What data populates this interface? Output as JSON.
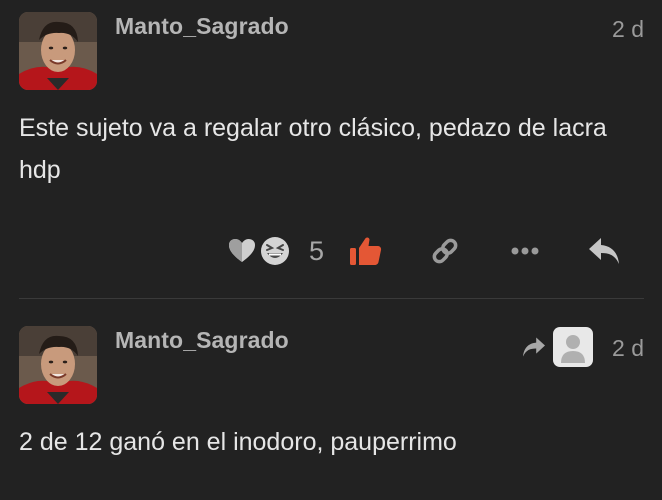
{
  "posts": [
    {
      "username": "Manto_Sagrado",
      "date": "2 d",
      "text": "Este sujeto va a regalar otro clásico, pedazo de lacra hdp",
      "reactions": {
        "icons": [
          "heart-icon",
          "grinning-squint-emoji"
        ],
        "count": "5"
      },
      "actions": [
        "thumbs-up-icon",
        "link-icon",
        "more-icon",
        "reply-icon"
      ]
    },
    {
      "username": "Manto_Sagrado",
      "date": "2 d",
      "text": "2 de 12 ganó en el inodoro, pauperrimo",
      "reply_to": {
        "icons": [
          "reply-arrow-icon",
          "default-user-avatar"
        ]
      }
    }
  ],
  "colors": {
    "background": "#222222",
    "username": "#b5b5b5",
    "text": "#e6e6e6",
    "muted": "#9a9a9a",
    "like_active": "#e45735"
  }
}
